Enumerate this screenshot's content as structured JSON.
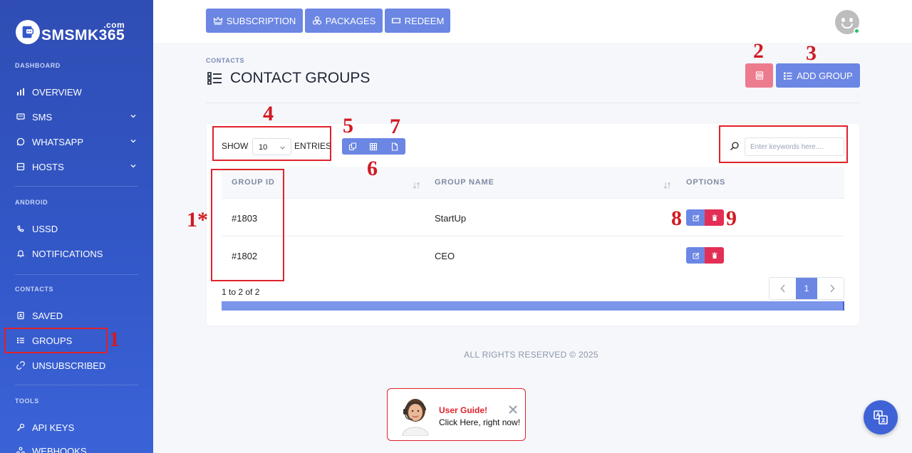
{
  "brand": {
    "name": "SMSMK365",
    "suffix": ".com"
  },
  "sidebar": {
    "sections": [
      {
        "label": "DASHBOARD"
      },
      {
        "label": "ANDROID"
      },
      {
        "label": "CONTACTS"
      },
      {
        "label": "TOOLS"
      }
    ],
    "items": [
      {
        "label": "OVERVIEW",
        "icon": "bar-chart-icon"
      },
      {
        "label": "SMS",
        "icon": "message-icon",
        "expandable": true
      },
      {
        "label": "WHATSAPP",
        "icon": "whatsapp-icon",
        "expandable": true
      },
      {
        "label": "HOSTS",
        "icon": "server-icon",
        "expandable": true
      },
      {
        "label": "USSD",
        "icon": "dial-icon"
      },
      {
        "label": "NOTIFICATIONS",
        "icon": "bell-icon"
      },
      {
        "label": "SAVED",
        "icon": "contact-icon"
      },
      {
        "label": "GROUPS",
        "icon": "list-icon",
        "active": true
      },
      {
        "label": "UNSUBSCRIBED",
        "icon": "unlink-icon"
      },
      {
        "label": "API KEYS",
        "icon": "key-icon"
      },
      {
        "label": "WEBHOOKS",
        "icon": "webhook-icon"
      }
    ]
  },
  "topbar": {
    "subscription": "SUBSCRIPTION",
    "packages": "PACKAGES",
    "redeem": "REDEEM"
  },
  "page": {
    "breadcrumb": "CONTACTS",
    "title": "CONTACT GROUPS",
    "add_group": "ADD GROUP"
  },
  "table": {
    "show_label": "SHOW",
    "page_size": "10",
    "entries_label": "ENTRIES",
    "search_placeholder": "Enter keywords here....",
    "columns": [
      "GROUP ID",
      "GROUP NAME",
      "OPTIONS"
    ],
    "rows": [
      {
        "id": "#1803",
        "name": "StartUp"
      },
      {
        "id": "#1802",
        "name": "CEO"
      }
    ],
    "info": "1 to 2 of 2",
    "current_page": "1"
  },
  "footer": {
    "text": "ALL RIGHTS RESERVED © 2025"
  },
  "guide": {
    "title": "User Guide!",
    "subtitle": "Click Here, right now!"
  },
  "annotations": {
    "a1": "1",
    "a1s": "1*",
    "a2": "2",
    "a3": "3",
    "a4": "4",
    "a5": "5",
    "a6": "6",
    "a7": "7",
    "a8": "8",
    "a9": "9"
  },
  "colors": {
    "sidebar": "#3358c9",
    "primary": "#6b86e3",
    "danger": "#e32f55",
    "annotation": "#d11a22"
  }
}
